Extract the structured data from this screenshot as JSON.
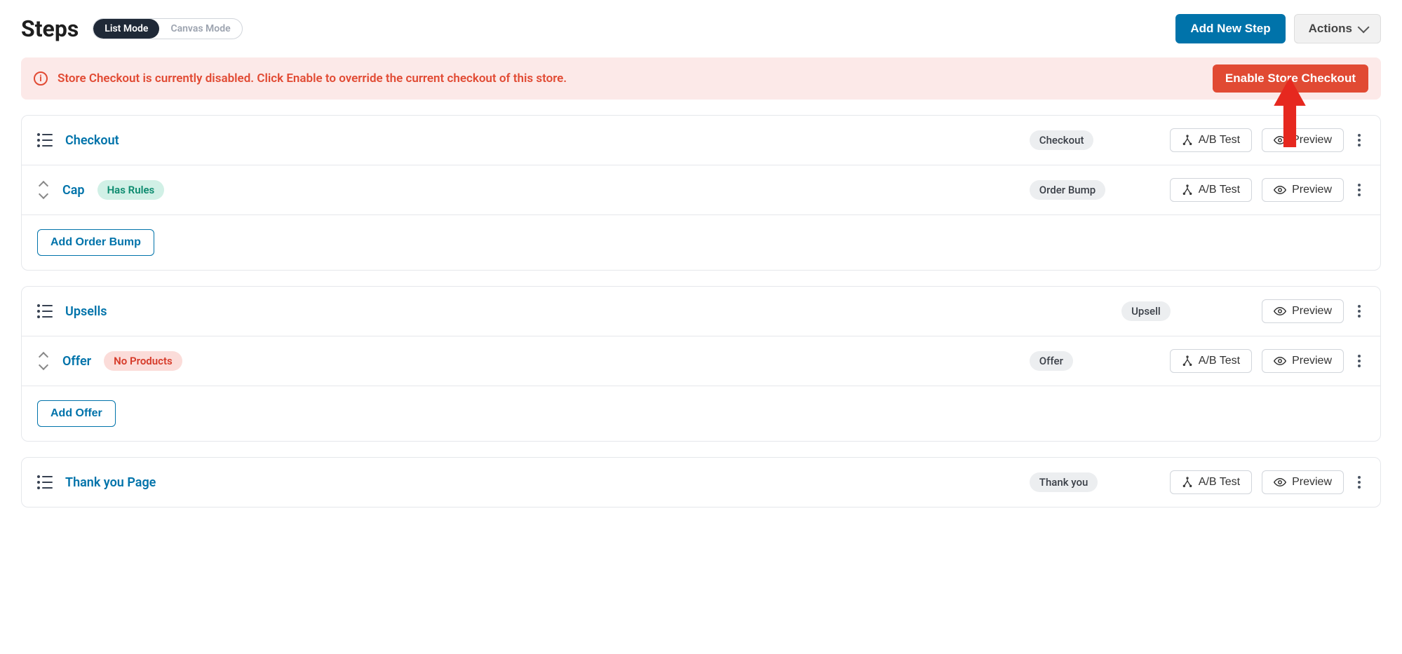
{
  "header": {
    "title": "Steps",
    "mode_list": "List Mode",
    "mode_canvas": "Canvas Mode",
    "add_step_label": "Add New Step",
    "actions_label": "Actions"
  },
  "alert": {
    "text": "Store Checkout is currently disabled. Click Enable to override the current checkout of this store.",
    "button_label": "Enable Store Checkout"
  },
  "labels": {
    "ab_test": "A/B Test",
    "preview": "Preview",
    "add_order_bump": "Add Order Bump",
    "add_offer": "Add Offer"
  },
  "badges": {
    "checkout": "Checkout",
    "order_bump": "Order Bump",
    "upsell": "Upsell",
    "offer": "Offer",
    "thankyou": "Thank you",
    "has_rules": "Has Rules",
    "no_products": "No Products"
  },
  "steps": {
    "checkout": {
      "title": "Checkout"
    },
    "cap": {
      "title": "Cap"
    },
    "upsells": {
      "title": "Upsells"
    },
    "offer": {
      "title": "Offer"
    },
    "thankyou": {
      "title": "Thank you Page"
    }
  }
}
